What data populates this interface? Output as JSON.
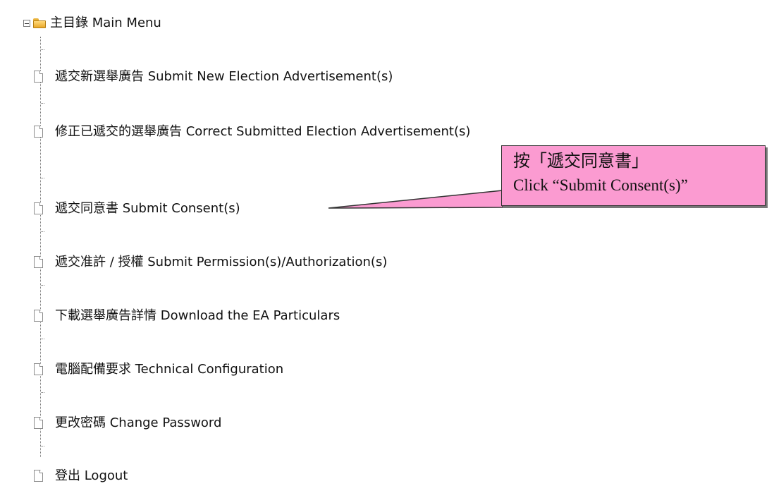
{
  "tree": {
    "root": {
      "label": "主目錄 Main Menu",
      "icon": "folder-open-icon",
      "expander": "collapse-icon"
    },
    "items": [
      {
        "label": "遞交新選舉廣告 Submit New Election Advertisement(s)",
        "icon": "document-icon"
      },
      {
        "label": "修正已遞交的選舉廣告 Correct Submitted Election Advertisement(s)",
        "icon": "document-icon"
      },
      {
        "label": "遞交同意書 Submit Consent(s)",
        "icon": "document-icon"
      },
      {
        "label": "遞交准許 / 授權 Submit Permission(s)/Authorization(s)",
        "icon": "document-icon"
      },
      {
        "label": "下載選舉廣告詳情 Download the EA Particulars",
        "icon": "document-icon"
      },
      {
        "label": "電腦配備要求 Technical Configuration",
        "icon": "document-icon"
      },
      {
        "label": "更改密碼 Change Password",
        "icon": "document-icon"
      },
      {
        "label": "登出 Logout",
        "icon": "document-icon"
      }
    ]
  },
  "callout": {
    "line1": "按「遞交同意書」",
    "line2": "Click “Submit Consent(s)”",
    "fill_color": "#fb9bd1",
    "border_color": "#333333"
  }
}
